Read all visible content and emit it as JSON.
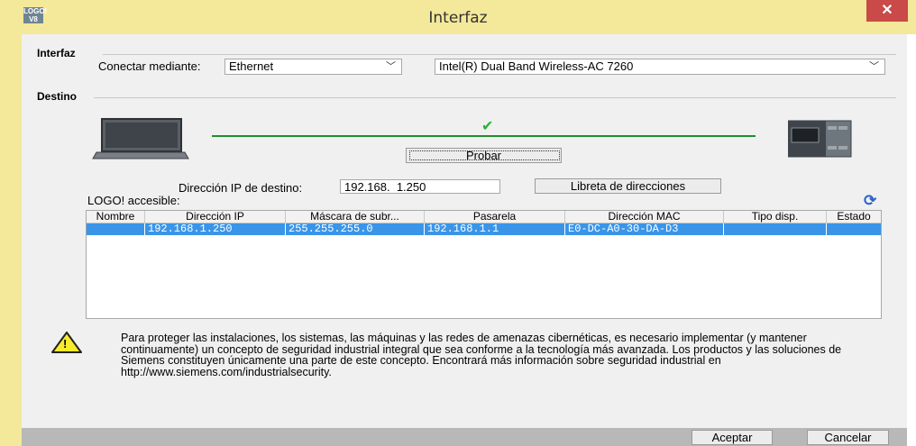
{
  "window": {
    "title": "Interfaz",
    "logo_text": "LOGO! V8",
    "close_symbol": "✕"
  },
  "interfaz": {
    "section_title": "Interfaz",
    "connect_label": "Conectar mediante:",
    "connect_value": "Ethernet",
    "adapter_value": "Intel(R) Dual Band Wireless-AC 7260"
  },
  "destino": {
    "section_title": "Destino",
    "check_symbol": "✔",
    "test_button": "Probar",
    "ip_label": "Dirección IP de destino:",
    "ip_value": "192.168.  1.250",
    "address_book_button": "Libreta de direcciones",
    "accessible_label": "LOGO! accesible:",
    "refresh_symbol": "⟳"
  },
  "table": {
    "columns": [
      "Nombre",
      "Dirección IP",
      "Máscara de subr...",
      "Pasarela",
      "Dirección MAC",
      "Tipo disp.",
      "Estado"
    ],
    "rows": [
      [
        "",
        "192.168.1.250",
        "255.255.255.0",
        "192.168.1.1",
        "E0-DC-A0-30-DA-D3",
        "",
        ""
      ]
    ]
  },
  "warning": {
    "icon_symbol": "!",
    "text": "Para proteger las instalaciones, los sistemas, las máquinas y las redes de amenazas cibernéticas, es necesario implementar (y mantener continuamente) un concepto de seguridad industrial integral que sea conforme a la tecnología más avanzada. Los productos y las soluciones de Siemens constituyen únicamente una parte de este concepto. Encontrará más información sobre seguridad industrial en http://www.siemens.com/industrialsecurity."
  },
  "footer": {
    "accept_button": "Aceptar",
    "cancel_button": "Cancelar"
  },
  "colors": {
    "title_bar": "#f4e89a",
    "selection": "#3a95e8",
    "connection_line": "#1f8f2d",
    "close_button": "#c94a48"
  }
}
